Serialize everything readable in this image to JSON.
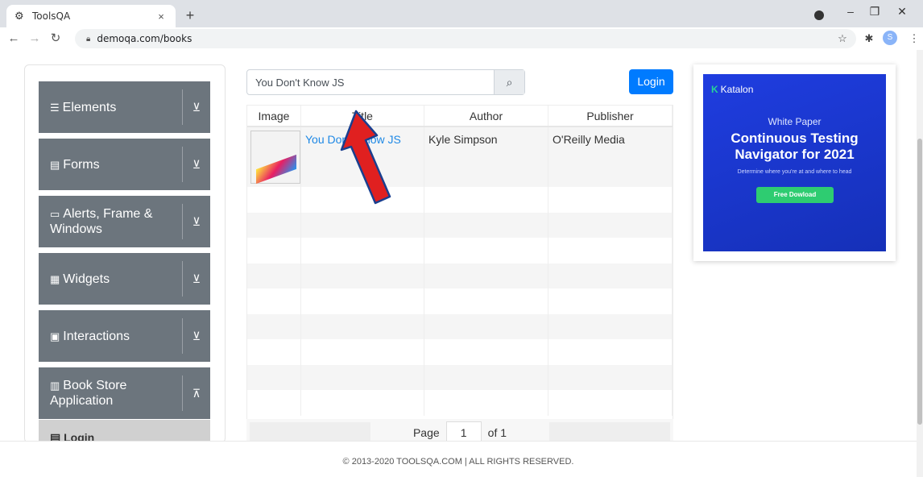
{
  "browser": {
    "tab_title": "ToolsQA",
    "tab_close": "×",
    "new_tab": "+",
    "url": "demoqa.com/books",
    "avatar_letter": "S"
  },
  "sidebar": {
    "groups": [
      {
        "label": "Elements",
        "arrow": "⊻"
      },
      {
        "label": "Forms",
        "arrow": "⊻"
      },
      {
        "label": "Alerts, Frame & Windows",
        "arrow": "⊻"
      },
      {
        "label": "Widgets",
        "arrow": "⊻"
      },
      {
        "label": "Interactions",
        "arrow": "⊻"
      },
      {
        "label": "Book Store Application",
        "arrow": "⊼"
      }
    ],
    "sub_item": "Login"
  },
  "search": {
    "value": "You Don't Know JS"
  },
  "login_button": "Login",
  "table": {
    "headers": [
      "Image",
      "Title",
      "Author",
      "Publisher"
    ],
    "rows": [
      {
        "title": "You Don't Know JS",
        "author": "Kyle Simpson",
        "publisher": "O'Reilly Media"
      }
    ]
  },
  "pager": {
    "page_label": "Page",
    "page_value": "1",
    "of_label": "of 1"
  },
  "ad": {
    "brand": "Katalon",
    "eyebrow": "White Paper",
    "headline_1": "Continuous Testing",
    "headline_2": "Navigator for 2021",
    "subtext": "Determine where you're at and where to head",
    "cta": "Free Dowload"
  },
  "footer": "© 2013-2020 TOOLSQA.COM | ALL RIGHTS RESERVED.",
  "colors": {
    "primary": "#007bff",
    "sidebar_group": "#6c757d",
    "link": "#1e88e5",
    "annotation": "#e02020"
  }
}
